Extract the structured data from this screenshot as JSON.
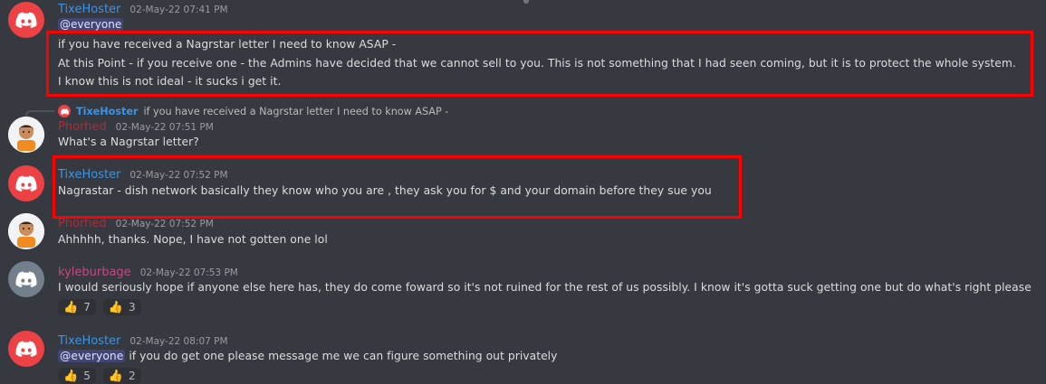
{
  "messages": [
    {
      "author": "TixeHoster",
      "timestamp": "02-May-22 07:41 PM",
      "mention": "@everyone",
      "lines": [
        "if you have received a Nagrstar letter I need to know ASAP -",
        "At this Point - if you receive one - the Admins have decided that we cannot sell to you. This is not something that I had seen coming, but it is to protect the whole system.",
        "I know this is not ideal - it sucks i get it."
      ]
    },
    {
      "reply": {
        "author": "TixeHoster",
        "text": "if you have received a Nagrstar letter I need to know ASAP -"
      },
      "author": "Phorhed",
      "timestamp": "02-May-22 07:51 PM",
      "text": "What's a Nagrstar letter?"
    },
    {
      "author": "TixeHoster",
      "timestamp": "02-May-22 07:52 PM",
      "text": "Nagrastar - dish network basically they know who you are , they ask you for $ and your domain before they sue you"
    },
    {
      "author": "Phorhed",
      "timestamp": "02-May-22 07:52 PM",
      "text": "Ahhhhh, thanks.  Nope, I have not gotten one lol"
    },
    {
      "author": "kyleburbage",
      "timestamp": "02-May-22 07:53 PM",
      "text": "I would seriously hope if anyone else here has, they do come foward so it's not ruined for the rest of us possibly. I know it's gotta suck getting one but do what's right please",
      "reactions": [
        {
          "emoji": "thumbs-up-yellow",
          "count": "7"
        },
        {
          "emoji": "thumbs-up-light",
          "count": "3"
        }
      ]
    },
    {
      "author": "TixeHoster",
      "timestamp": "02-May-22 08:07 PM",
      "mention": "@everyone",
      "text": "if you do get one please message me we can figure something out privately",
      "reactions": [
        {
          "emoji": "thumbs-up-yellow",
          "count": "5"
        },
        {
          "emoji": "thumbs-up-light",
          "count": "2"
        }
      ]
    }
  ],
  "colors": {
    "background": "#36393f",
    "discord_blurple_red": "#ed4245",
    "highlight_red": "#ff0000",
    "username_blue": "#3a94e8"
  }
}
